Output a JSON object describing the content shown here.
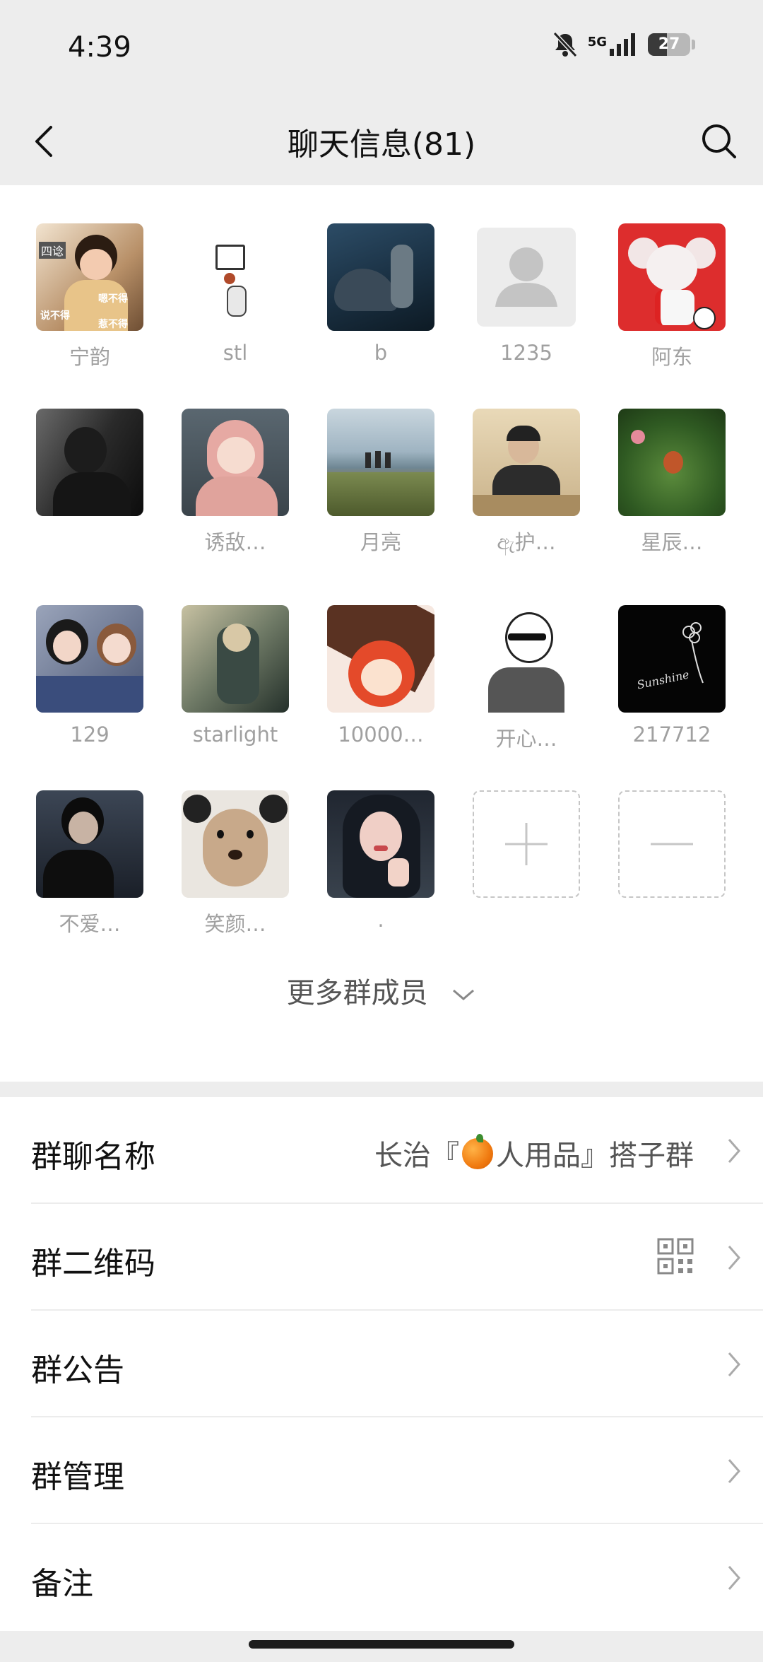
{
  "status_bar": {
    "time": "4:39",
    "network": "5G",
    "battery": "27"
  },
  "nav": {
    "title": "聊天信息(81)"
  },
  "members": [
    {
      "name": "宁韵",
      "avatar": "avatar-ningyun",
      "overlay": [
        "四谂",
        "嗯不得",
        "说不得",
        "惹不得"
      ]
    },
    {
      "name": "stl",
      "avatar": "avatar-stl"
    },
    {
      "name": "b",
      "avatar": "avatar-b"
    },
    {
      "name": "1235",
      "avatar": "default-person-icon"
    },
    {
      "name": "阿东",
      "avatar": "avatar-adong"
    },
    {
      "name": "",
      "avatar": "avatar-dark"
    },
    {
      "name": "诱敌…",
      "avatar": "avatar-youdi"
    },
    {
      "name": "月亮",
      "avatar": "avatar-yueliang"
    },
    {
      "name": "ඇ护…",
      "avatar": "avatar-hu"
    },
    {
      "name": "星辰…",
      "avatar": "avatar-xingchen"
    },
    {
      "name": "129",
      "avatar": "avatar-129"
    },
    {
      "name": "starlight",
      "avatar": "avatar-starlight"
    },
    {
      "name": "10000…",
      "avatar": "avatar-10000"
    },
    {
      "name": "开心…",
      "avatar": "avatar-kaixin"
    },
    {
      "name": "217712",
      "avatar": "avatar-217712",
      "overlay": [
        "Sunshine"
      ]
    },
    {
      "name": "不爱…",
      "avatar": "avatar-buai"
    },
    {
      "name": "笑颜…",
      "avatar": "avatar-xiaoyan"
    },
    {
      "name": ".",
      "avatar": "avatar-dot"
    }
  ],
  "add_member_icon": "plus-icon",
  "remove_member_icon": "minus-icon",
  "more_members": "更多群成员",
  "settings": [
    {
      "label": "群聊名称",
      "value_prefix": "长治『",
      "value_suffix": "人用品』搭子群",
      "emoji": "orange"
    },
    {
      "label": "群二维码",
      "icon": "qr-code-icon"
    },
    {
      "label": "群公告"
    },
    {
      "label": "群管理"
    },
    {
      "label": "备注"
    }
  ]
}
